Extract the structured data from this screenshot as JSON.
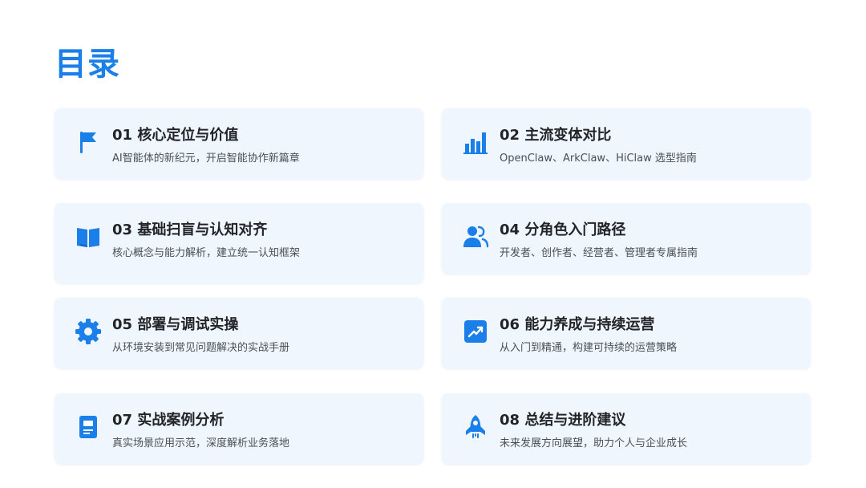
{
  "page": {
    "title": "目录",
    "accent_color": "#1a7fe8",
    "card_background": "#eff6fe"
  },
  "items": [
    {
      "icon": "flag-icon",
      "title": "01 核心定位与价值",
      "subtitle": "AI智能体的新纪元，开启智能协作新篇章"
    },
    {
      "icon": "bar-chart-icon",
      "title": "02 主流变体对比",
      "subtitle": "OpenClaw、ArkClaw、HiClaw 选型指南"
    },
    {
      "icon": "book-icon",
      "title": "03 基础扫盲与认知对齐",
      "subtitle": "核心概念与能力解析，建立统一认知框架"
    },
    {
      "icon": "users-icon",
      "title": "04 分角色入门路径",
      "subtitle": "开发者、创作者、经营者、管理者专属指南"
    },
    {
      "icon": "gear-icon",
      "title": "05 部署与调试实操",
      "subtitle": "从环境安装到常见问题解决的实战手册"
    },
    {
      "icon": "trending-up-icon",
      "title": "06 能力养成与持续运营",
      "subtitle": "从入门到精通，构建可持续的运营策略"
    },
    {
      "icon": "document-icon",
      "title": "07 实战案例分析",
      "subtitle": "真实场景应用示范，深度解析业务落地"
    },
    {
      "icon": "rocket-icon",
      "title": "08 总结与进阶建议",
      "subtitle": "未来发展方向展望，助力个人与企业成长"
    }
  ]
}
